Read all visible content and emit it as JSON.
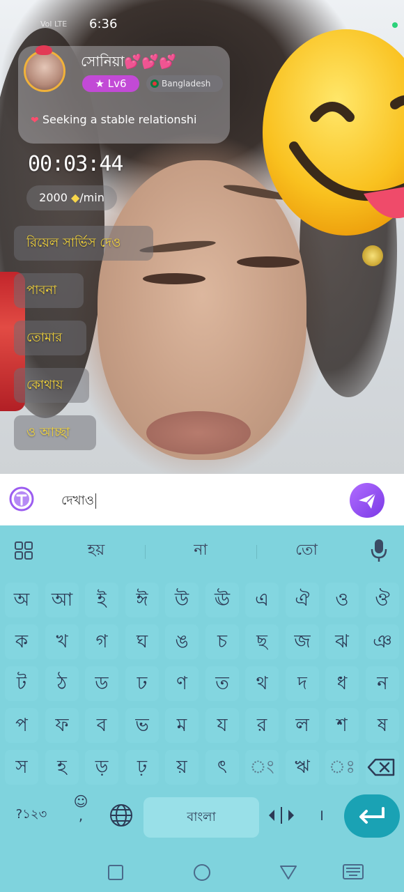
{
  "status_bar": {
    "time": "6:36",
    "carrier": "Vol LTE"
  },
  "host": {
    "name": "সোনিয়া",
    "hearts": "💕💕💕",
    "level": "Lv6",
    "country": "Bangladesh",
    "bio": "Seeking a stable relationshi"
  },
  "call": {
    "timer": "00:03:44",
    "rate_amount": "2000",
    "rate_unit": "/min"
  },
  "chat_messages": [
    "রিয়েল সার্ভিস দেও",
    "পাবনা",
    "তোমার",
    "কোথায়",
    "ও আচ্ছা"
  ],
  "input": {
    "value": "দেখাও"
  },
  "keyboard": {
    "suggestions": [
      "হয়",
      "না",
      "তো"
    ],
    "rows": [
      [
        "অ",
        "আ",
        "ই",
        "ঈ",
        "উ",
        "ঊ",
        "এ",
        "ঐ",
        "ও",
        "ঔ"
      ],
      [
        "ক",
        "খ",
        "গ",
        "ঘ",
        "ঙ",
        "চ",
        "ছ",
        "জ",
        "ঝ",
        "ঞ"
      ],
      [
        "ট",
        "ঠ",
        "ড",
        "ঢ",
        "ণ",
        "ত",
        "থ",
        "দ",
        "ধ",
        "ন"
      ],
      [
        "প",
        "ফ",
        "ব",
        "ভ",
        "ম",
        "য",
        "র",
        "ল",
        "শ",
        "ষ"
      ],
      [
        "স",
        "হ",
        "ড়",
        "ঢ়",
        "য়",
        "ৎ",
        "ং",
        "ঋ",
        "ঃ"
      ]
    ],
    "symbols_label": "?১২৩",
    "emoji_key": "☺",
    "comma": ",",
    "space_label": "বাংলা",
    "period": "।"
  },
  "colors": {
    "keyboard_bg": "#7fd3dd",
    "key_bg": "#83d6e0",
    "enter_bg": "#1aa2b4",
    "send_bg": "#8b45f0",
    "level_badge": "#c24ad6"
  }
}
